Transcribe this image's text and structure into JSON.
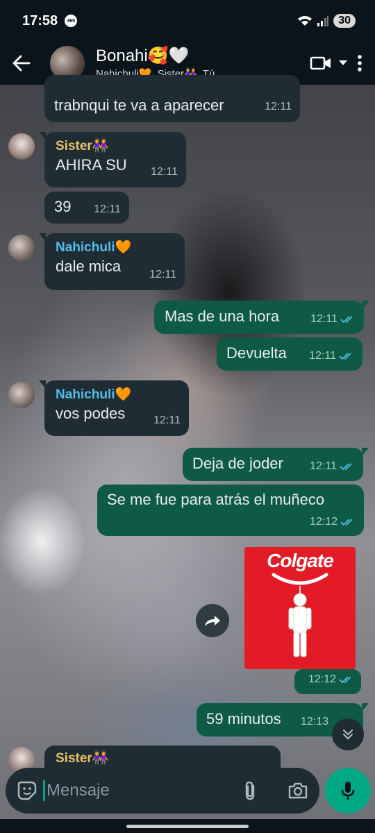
{
  "status": {
    "time": "17:58",
    "badge": "365",
    "battery": "30"
  },
  "header": {
    "title": "Bonahi🥰🤍",
    "subtitle": "Nahichuli🧡, Sister👭, Tú"
  },
  "messages": [
    {
      "type": "in",
      "text": "trabnqui te va a aparecer",
      "time": "12:11"
    },
    {
      "type": "in",
      "sender": "Sister👭",
      "text": "AHIRA SU",
      "time": "12:11"
    },
    {
      "type": "in",
      "text": "39",
      "time": "12:11"
    },
    {
      "type": "in",
      "sender": "Nahichuli🧡",
      "text": "dale mica",
      "time": "12:11"
    },
    {
      "type": "out",
      "text": "Mas de una hora",
      "time": "12:11"
    },
    {
      "type": "out",
      "text": "Devuelta",
      "time": "12:11"
    },
    {
      "type": "in",
      "sender": "Nahichuli🧡",
      "text": "vos podes",
      "time": "12:11"
    },
    {
      "type": "out",
      "text": "Deja de joder",
      "time": "12:11"
    },
    {
      "type": "out",
      "text": "Se me fue para atrás el muñeco",
      "time": "12:12"
    },
    {
      "type": "out-image",
      "image_caption": "Colgate",
      "time": "12:12"
    },
    {
      "type": "out",
      "text": "59 minutos",
      "time": "12:13"
    },
    {
      "type": "in",
      "sender": "Sister👭"
    }
  ],
  "composer": {
    "placeholder": "Mensaje"
  },
  "colors": {
    "incoming_bubble": "#202c33",
    "outgoing_bubble": "#0e5a44",
    "accent": "#00a884",
    "sender_sister": "#e8c068",
    "sender_nahichuli": "#53bdeb",
    "read_ticks": "#53bdeb"
  }
}
